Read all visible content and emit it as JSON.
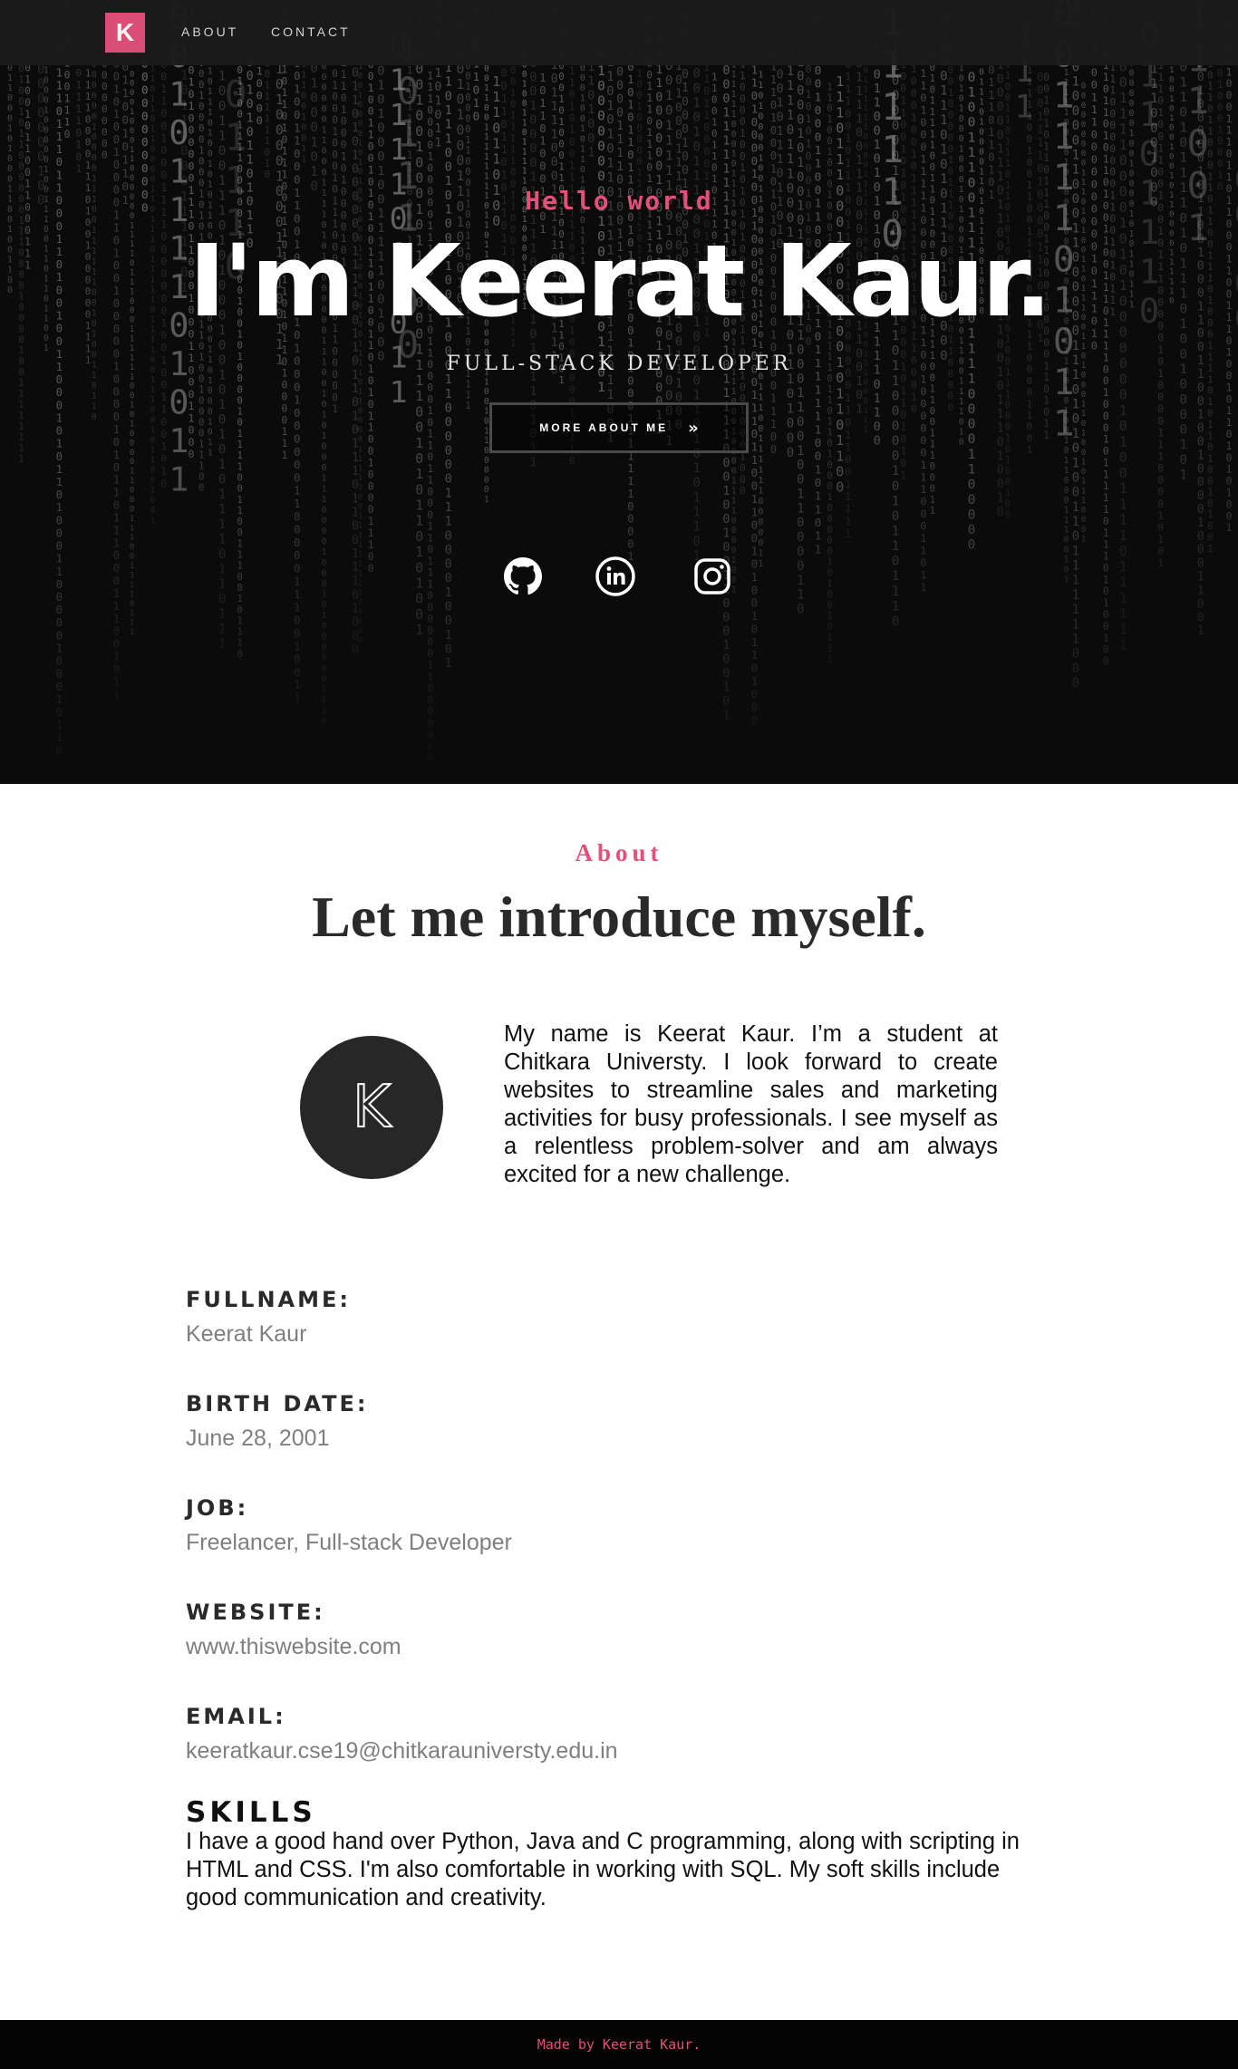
{
  "colors": {
    "accent": "#e3507a",
    "hero_bg": "#0c0c0c",
    "nav_bg": "#1b1b1b",
    "text_dark": "#2a2a2a",
    "text_muted": "#7f7f7f",
    "footer_bg": "#030303"
  },
  "nav": {
    "logo_letter": "K",
    "links": [
      {
        "label": "ABOUT"
      },
      {
        "label": "CONTACT"
      }
    ]
  },
  "hero": {
    "greeting": "Hello world",
    "name": "I'm Keerat Kaur.",
    "role": "FULL-STACK DEVELOPER",
    "cta_label": "MORE ABOUT ME",
    "cta_arrow": "»",
    "social": [
      {
        "icon": "github-icon"
      },
      {
        "icon": "linkedin-icon"
      },
      {
        "icon": "instagram-icon"
      }
    ]
  },
  "about": {
    "kicker": "About",
    "title": "Let me introduce myself.",
    "avatar_letter": "K",
    "intro": "My name is Keerat Kaur. I’m a student at Chitkara Universty. I look forward to create websites to streamline sales and marketing activities for busy professionals. I see myself as a relentless problem-solver and am always excited for a new challenge.",
    "info": [
      {
        "label": "FULLNAME:",
        "value": "Keerat Kaur"
      },
      {
        "label": "BIRTH DATE:",
        "value": "June 28, 2001"
      },
      {
        "label": "JOB:",
        "value": "Freelancer, Full-stack Developer"
      },
      {
        "label": "WEBSITE:",
        "value": "www.thiswebsite.com"
      },
      {
        "label": "EMAIL:",
        "value": "keeratkaur.cse19@chitkarauniversty.edu.in"
      }
    ],
    "skills_title": "SKILLS",
    "skills_text": "I have a good hand over Python, Java and C programming, along with scripting in HTML and CSS. I'm also comfortable in working with SQL. My soft skills include good communication and creativity."
  },
  "footer": {
    "text": "Made by Keerat Kaur."
  }
}
